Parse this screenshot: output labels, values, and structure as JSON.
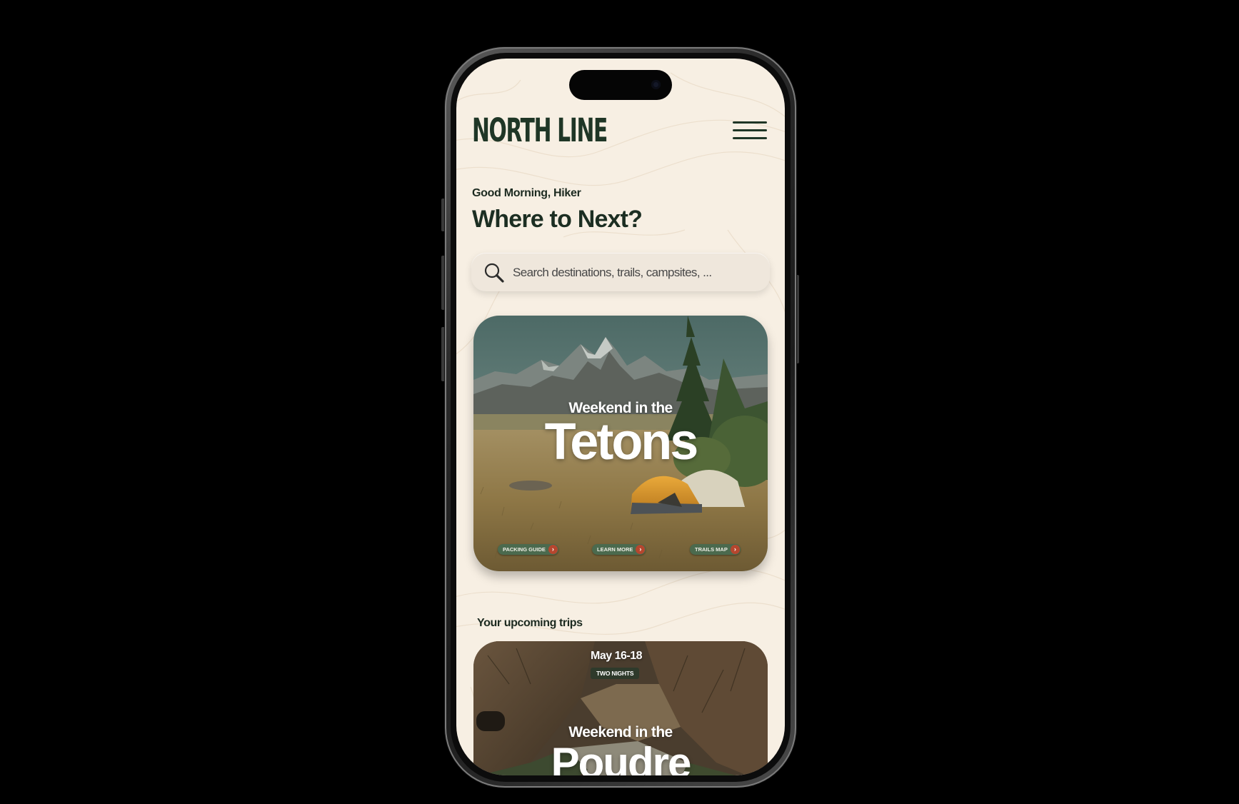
{
  "app": {
    "brand": "NORTH LINE"
  },
  "header": {
    "greeting": "Good Morning, Hiker",
    "headline": "Where to Next?"
  },
  "search": {
    "placeholder": "Search destinations, trails, campsites, ..."
  },
  "featured": {
    "kicker": "Weekend in the",
    "title": "Tetons",
    "actions": [
      {
        "label": "PACKING GUIDE",
        "icon": "chevron-right-icon"
      },
      {
        "label": "LEARN MORE",
        "icon": "chevron-right-icon"
      },
      {
        "label": "TRAILS MAP",
        "icon": "chevron-right-icon"
      }
    ]
  },
  "upcoming": {
    "section_label": "Your upcoming trips",
    "trips": [
      {
        "date": "May 16-18",
        "badge": "TWO NIGHTS",
        "kicker": "Weekend in the",
        "title": "Poudre"
      }
    ]
  },
  "colors": {
    "brand_green": "#1f3626",
    "background": "#f7efe3",
    "chip_green": "#4b6a4e",
    "chip_arrow": "#b6462e"
  }
}
